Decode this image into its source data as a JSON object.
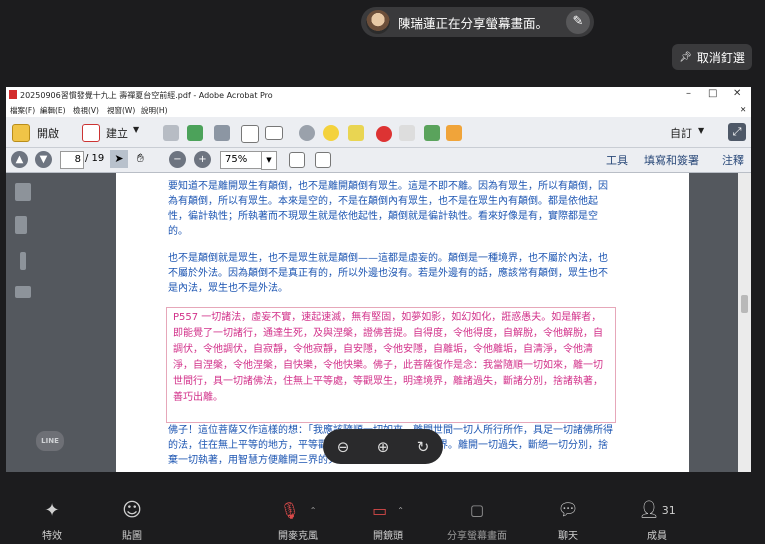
{
  "meeting": {
    "sharing_text": "陳瑞蓮正在分享螢幕畫面。",
    "unpin_label": "取消釘選"
  },
  "acrobat": {
    "title": "20250906習慣發覺十九上 壽禪夏台空前經.pdf - Adobe Acrobat Pro",
    "menu": [
      "檔案(F)",
      "編輯(E)",
      "檢視(V)",
      "視窗(W)",
      "說明(H)"
    ],
    "open_label": "開啟",
    "create_label": "建立",
    "sign_label": "自訂",
    "page_current": "8",
    "page_total": "/ 19",
    "zoom": "75%",
    "tabs": [
      "工具",
      "填寫和簽署",
      "注釋"
    ]
  },
  "document": {
    "paragraphs": [
      "要知道不是離開眾生有顛倒，也不是離開顛倒有眾生。這是不即不離。因為有眾生，所以有顛倒，因為有顛倒，所以有眾生。本來是空的，不是在顛倒內有眾生，也不是在眾生內有顛倒。都是依他起性，徧計執性；所執著而不現眾生就是依他起性，顛倒就是徧計執性。看來好像是有，實際都是空的。",
      "也不是顛倒就是眾生，也不是眾生就是顛倒——這都是虛妄的。顛倒是一種境界，也不屬於內法，也不屬於外法。因為顛倒不是真正有的，所以外邊也沒有。若是外邊有的話，應該常有顛倒，眾生也不是內法，眾生也不是外法。"
    ],
    "quote": "P557 一切諸法，虛妄不實，速起速滅，無有堅固，如夢如影，如幻如化，誑惑愚夫。如是解者，即能覺了一切諸行，通達生死，及與涅槃，證佛菩提。自得度，令他得度，自解脫，令他解脫，自調伏，令他調伏，自寂靜，令他寂靜，自安隱，令他安隱，自離垢，令他離垢，自清淨，令他清淨，自涅槃，令他涅槃，自快樂，令他快樂。佛子，此菩薩復作是念：我當隨順一切如來，離一切世間行，具一切諸佛法，住無上平等處，等觀眾生，明達境界，離諸過失，斷諸分別，捨諸執著，善巧出離。",
    "after": "佛子！這位菩薩又作這樣的想：「我應該隨順一切如來，離開世間一切人所行所作，具足一切諸佛所得的法，住在無上平等的地方，平等觀察一切眾生，明白一切境界。離開一切過失，斷絕一切分別，捨棄一切執著，用智慧方便離開三界的火宅。"
  },
  "controls": {
    "effects": "特效",
    "stickers": "貼圖",
    "mic": "開麥克風",
    "camera": "開鏡頭",
    "share": "分享螢幕畫面",
    "chat": "聊天",
    "members": "成員",
    "member_count": "31",
    "line_logo": "LINE"
  }
}
